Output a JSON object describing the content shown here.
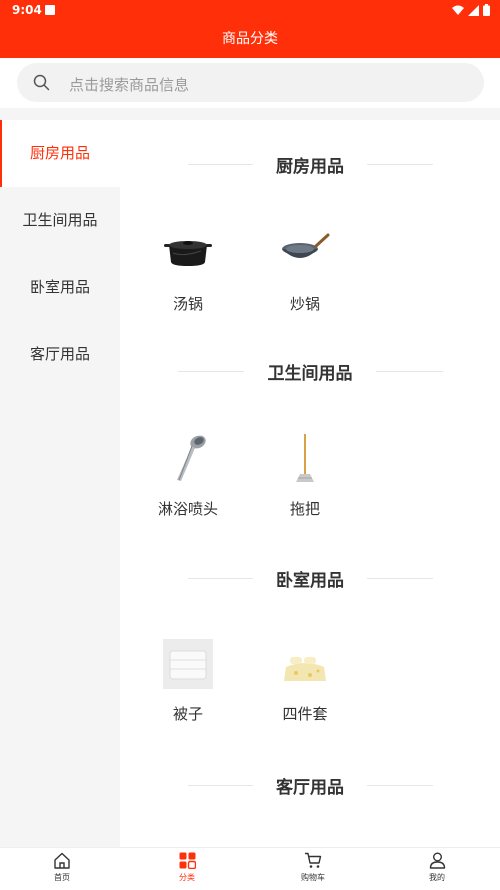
{
  "status_bar": {
    "time": "9:04"
  },
  "header": {
    "title": "商品分类"
  },
  "search": {
    "placeholder": "点击搜索商品信息"
  },
  "sidebar": {
    "items": [
      {
        "label": "厨房用品",
        "active": true
      },
      {
        "label": "卫生间用品",
        "active": false
      },
      {
        "label": "卧室用品",
        "active": false
      },
      {
        "label": "客厅用品",
        "active": false
      }
    ]
  },
  "sections": [
    {
      "title": "厨房用品",
      "products": [
        {
          "name": "汤锅",
          "icon": "soup-pot"
        },
        {
          "name": "炒锅",
          "icon": "wok"
        }
      ]
    },
    {
      "title": "卫生间用品",
      "products": [
        {
          "name": "淋浴喷头",
          "icon": "shower-head"
        },
        {
          "name": "拖把",
          "icon": "mop"
        }
      ]
    },
    {
      "title": "卧室用品",
      "products": [
        {
          "name": "被子",
          "icon": "quilt"
        },
        {
          "name": "四件套",
          "icon": "bedding-set"
        }
      ]
    },
    {
      "title": "客厅用品",
      "products": []
    }
  ],
  "bottom_nav": {
    "items": [
      {
        "label": "首页",
        "icon": "home-icon",
        "active": false
      },
      {
        "label": "分类",
        "icon": "category-icon",
        "active": true
      },
      {
        "label": "购物车",
        "icon": "cart-icon",
        "active": false
      },
      {
        "label": "我的",
        "icon": "user-icon",
        "active": false
      }
    ]
  },
  "colors": {
    "accent": "#ff2f0a",
    "sidebar_bg": "#f5f5f5",
    "search_bg": "#f2f2f2",
    "text": "#333333",
    "placeholder": "#9a9a9a"
  }
}
